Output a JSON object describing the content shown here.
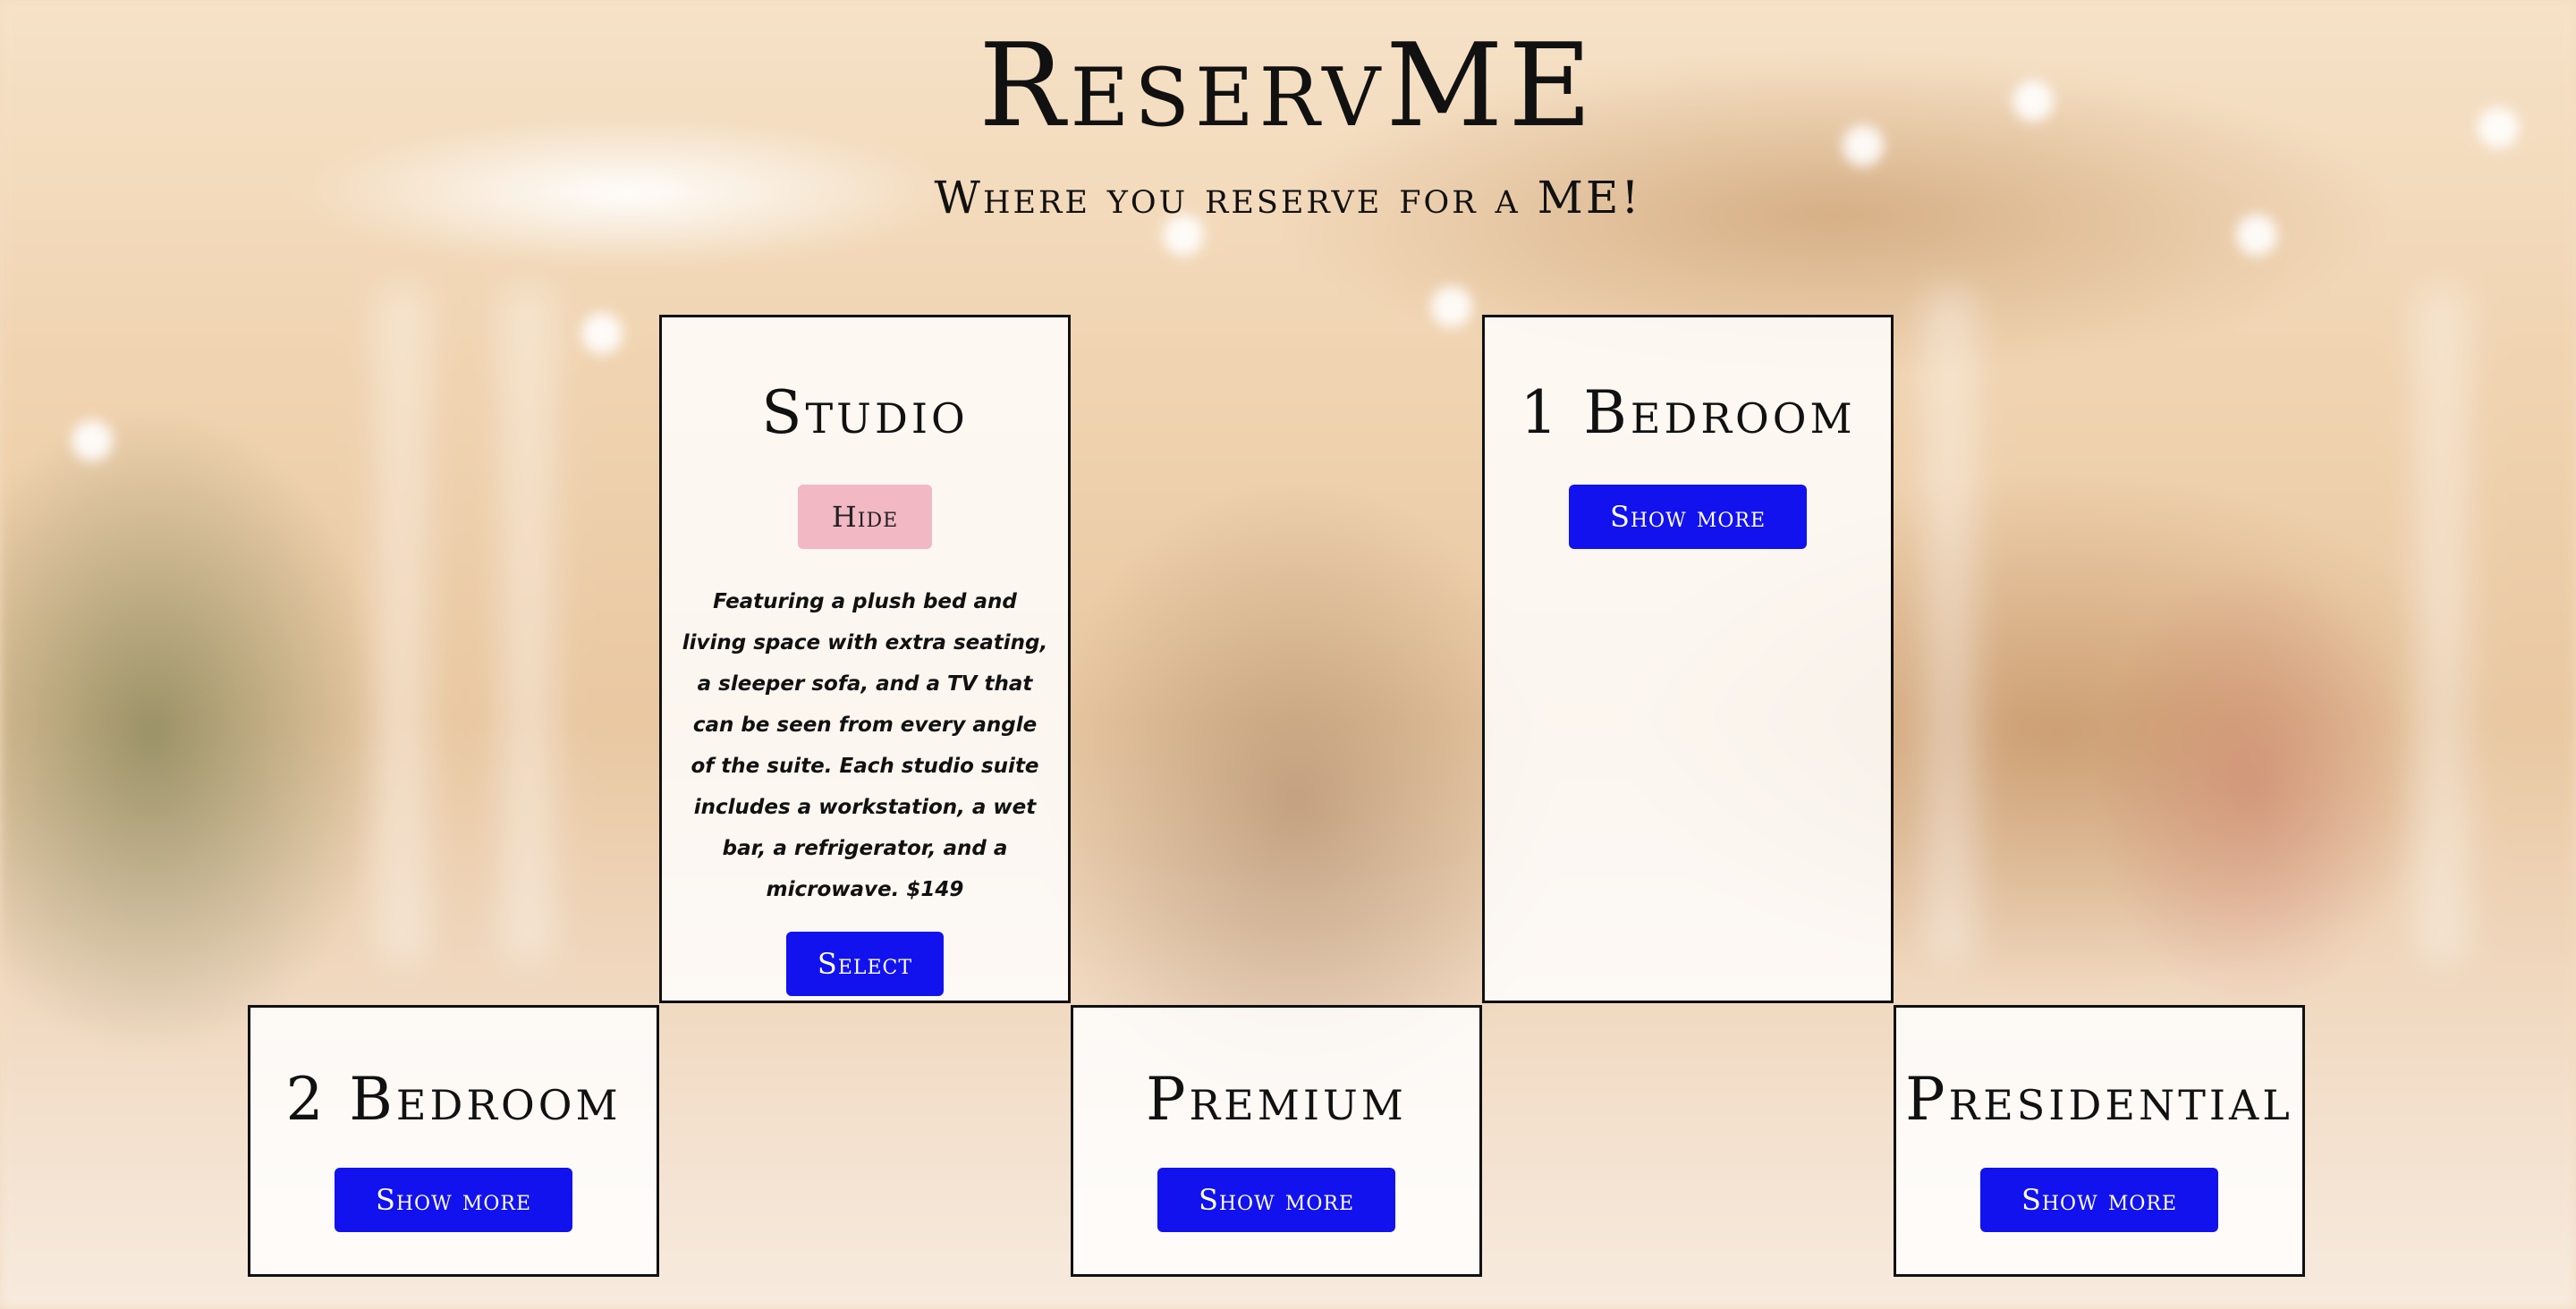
{
  "header": {
    "title": "ReservME",
    "subtitle": "Where you reserve for a ME!"
  },
  "rooms": {
    "studio": {
      "name": "Studio",
      "toggle_label": "Hide",
      "description": "Featuring a plush bed and living space with extra seating, a sleeper sofa, and a TV that can be seen from every angle of the suite. Each studio suite includes a workstation, a wet bar, a refrigerator, and a microwave. $149",
      "select_label": "Select",
      "expanded": true
    },
    "one_bedroom": {
      "name": "1 Bedroom",
      "toggle_label": "Show more",
      "expanded": false
    },
    "two_bedroom": {
      "name": "2 Bedroom",
      "toggle_label": "Show more",
      "expanded": false
    },
    "premium": {
      "name": "Premium",
      "toggle_label": "Show more",
      "expanded": false
    },
    "presidential": {
      "name": "Presidential",
      "toggle_label": "Show more",
      "expanded": false
    }
  },
  "colors": {
    "primary_button": "#1212ee",
    "hide_button": "#f2b8c3",
    "card_border": "#111111"
  }
}
